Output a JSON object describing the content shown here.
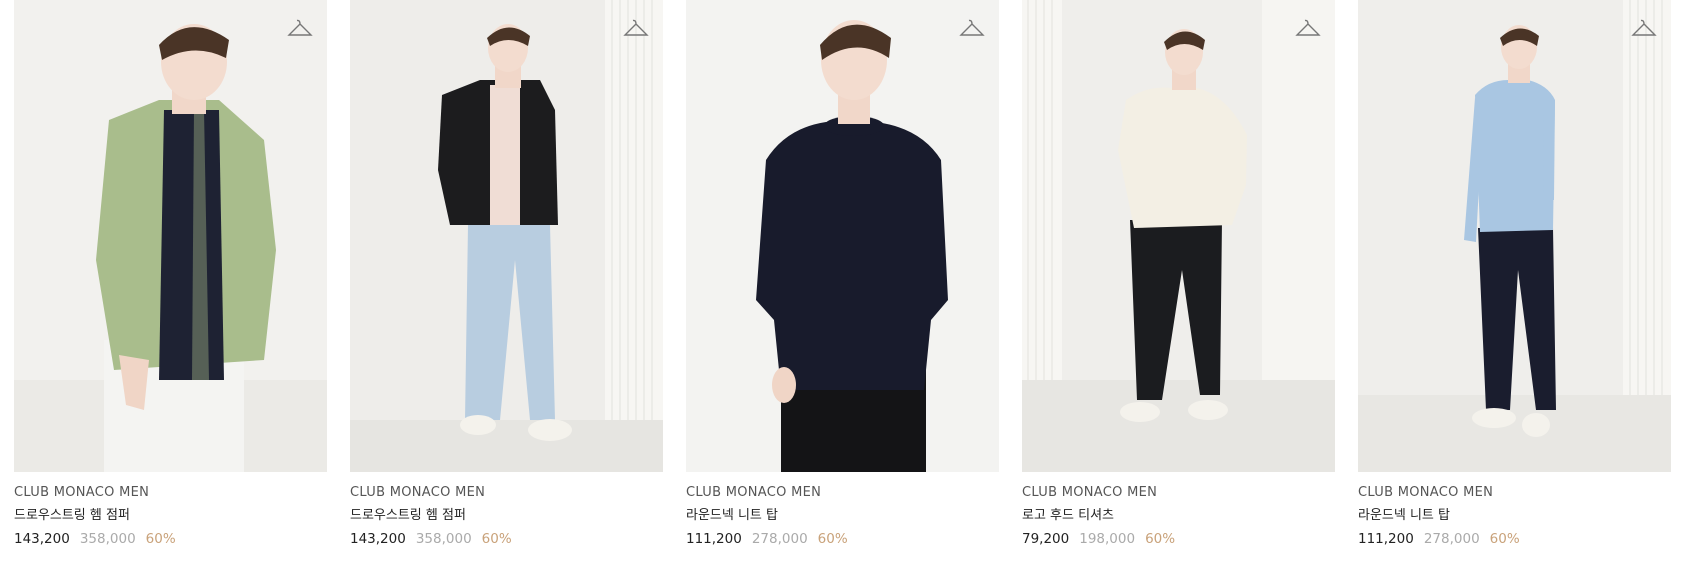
{
  "colors": {
    "accent_discount": "#c9a27a",
    "original_price": "#aaaaaa",
    "text": "#222222"
  },
  "products": [
    {
      "brand": "CLUB MONACO MEN",
      "name": "드로우스트링 헴 점퍼",
      "sale_price": "143,200",
      "original_price": "358,000",
      "discount": "60%",
      "wishlist_icon": "hanger-icon",
      "colors": {
        "bg": "#f2f1ee",
        "top": "#a9bd8c",
        "inner": "#1e2233",
        "bottom": "#f4f4f2",
        "floor": "#ebeae6"
      }
    },
    {
      "brand": "CLUB MONACO MEN",
      "name": "드로우스트링 헴 점퍼",
      "sale_price": "143,200",
      "original_price": "358,000",
      "discount": "60%",
      "wishlist_icon": "hanger-icon",
      "colors": {
        "bg": "#eeedea",
        "top": "#1c1c1e",
        "inner": "#f0ddd5",
        "bottom": "#b8cde0",
        "floor": "#e6e5e1"
      }
    },
    {
      "brand": "CLUB MONACO MEN",
      "name": "라운드넥 니트 탑",
      "sale_price": "111,200",
      "original_price": "278,000",
      "discount": "60%",
      "wishlist_icon": "hanger-icon",
      "colors": {
        "bg": "#f3f3f1",
        "top": "#181b2c",
        "inner": "#181b2c",
        "bottom": "#141416",
        "floor": "#efefed"
      }
    },
    {
      "brand": "CLUB MONACO MEN",
      "name": "로고 후드 티셔츠",
      "sale_price": "79,200",
      "original_price": "198,000",
      "discount": "60%",
      "wishlist_icon": "hanger-icon",
      "colors": {
        "bg": "#efeeeb",
        "top": "#f3efe4",
        "inner": "#f3efe4",
        "bottom": "#1b1c1f",
        "floor": "#e7e6e2"
      }
    },
    {
      "brand": "CLUB MONACO MEN",
      "name": "라운드넥 니트 탑",
      "sale_price": "111,200",
      "original_price": "278,000",
      "discount": "60%",
      "wishlist_icon": "hanger-icon",
      "colors": {
        "bg": "#efeeeb",
        "top": "#a9c6e2",
        "inner": "#a9c6e2",
        "bottom": "#1a1d2e",
        "floor": "#e8e7e3"
      }
    }
  ]
}
